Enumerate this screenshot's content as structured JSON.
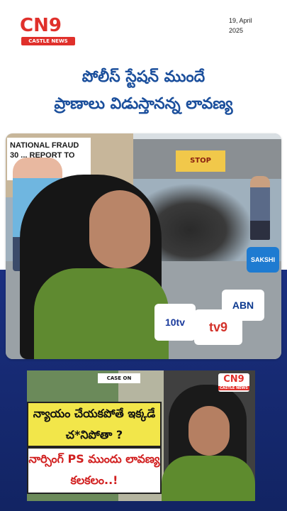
{
  "header": {
    "logo_text": "CN9",
    "logo_subtitle": "CASTLE NEWS",
    "date_line1": "19, April",
    "date_line2": "2025"
  },
  "headline": {
    "line1": "పోలీస్ స్టేషన్ ముందే",
    "line2": "ప్రాణాలు విడుస్తానన్న లావణ్య"
  },
  "video": {
    "sign_text": "NATIONAL FRAUD 30 ... REPORT TO",
    "yellow_sign_text": "STOP",
    "mic_labels": [
      "10tv",
      "tv9",
      "ABN",
      "SAKSHI"
    ]
  },
  "thumbnail": {
    "case_label": "CASE ON",
    "callout_top": "న్యాయం చేయకపోతే ఇక్కడే చ*నిపోతా ?",
    "callout_bottom": "నార్సింగ్ PS ముందు లావణ్య కలకలం..!",
    "logo_text": "CN9",
    "logo_subtitle": "CASTLE NEWS"
  },
  "colors": {
    "brand_red": "#e0302b",
    "brand_navy": "#1f2f6b",
    "headline_blue": "#1b4f9c",
    "band_blue": "#1a2f80"
  }
}
